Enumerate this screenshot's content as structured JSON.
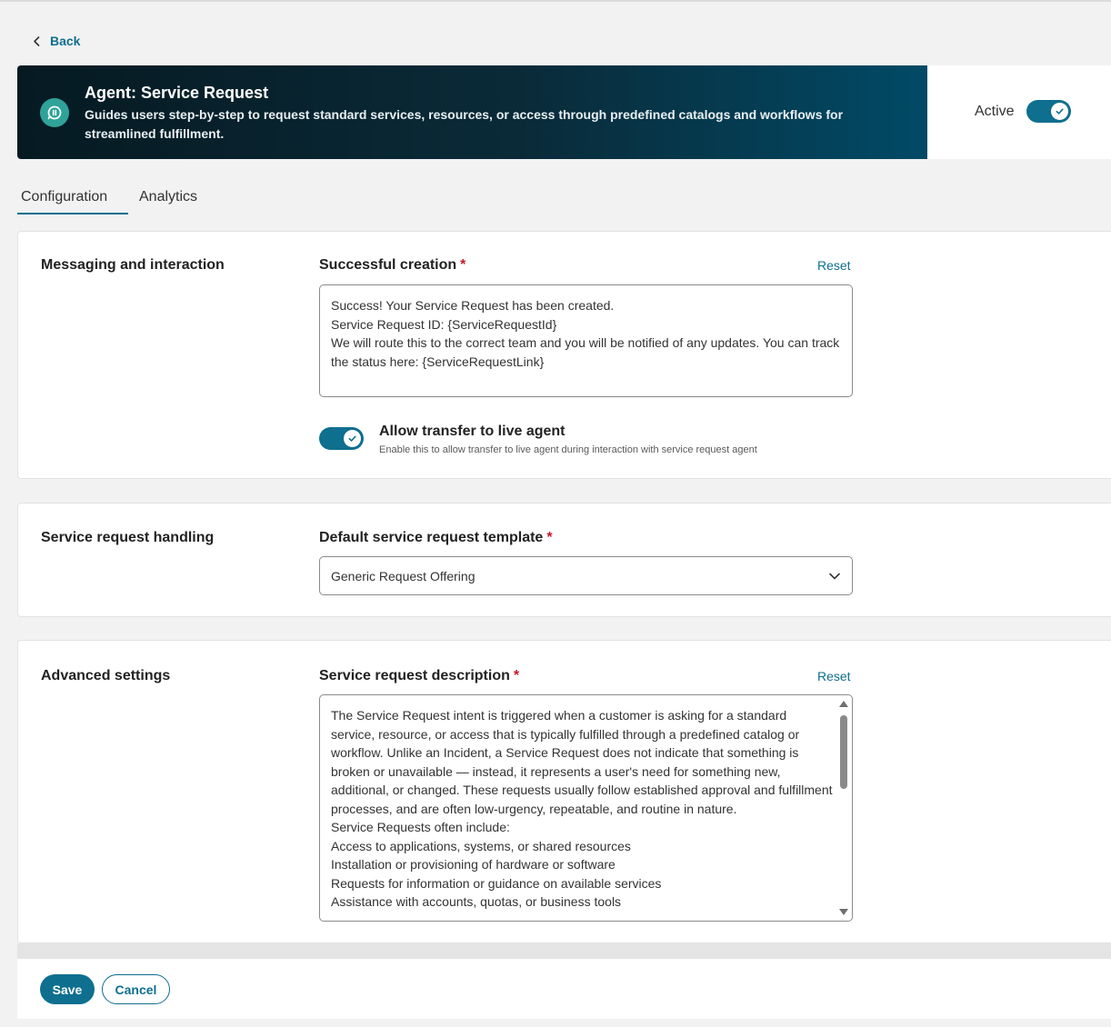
{
  "nav": {
    "back_label": "Back"
  },
  "banner": {
    "title": "Agent: Service Request",
    "description": "Guides users step-by-step to request standard services, resources, or access through predefined catalogs and workflows for streamlined fulfillment.",
    "icon": "chat-bubble-icon"
  },
  "status": {
    "label": "Active",
    "enabled": true
  },
  "tabs": [
    {
      "label": "Configuration",
      "selected": true
    },
    {
      "label": "Analytics",
      "selected": false
    }
  ],
  "messaging": {
    "section_title": "Messaging and interaction",
    "field_label": "Successful creation",
    "required_mark": "*",
    "reset_label": "Reset",
    "message_lines": [
      "Success! Your Service Request has been created.",
      "Service Request ID: {ServiceRequestId}",
      "We will route this to the correct team and you will be notified of any updates. You can track the status here: {ServiceRequestLink}"
    ],
    "transfer_title": "Allow transfer to live agent",
    "transfer_subtitle": "Enable this to allow transfer to live agent during interaction with service request agent",
    "transfer_enabled": true
  },
  "handling": {
    "section_title": "Service request handling",
    "field_label": "Default service request template",
    "required_mark": "*",
    "selected_value": "Generic Request Offering"
  },
  "advanced": {
    "section_title": "Advanced settings",
    "field_label": "Service request description",
    "required_mark": "*",
    "reset_label": "Reset",
    "description_lines": [
      "The Service Request intent is triggered when a customer is asking for a standard service, resource, or access that is typically fulfilled through a predefined catalog or workflow. Unlike an Incident, a Service Request does not indicate that something is broken or unavailable — instead, it represents a user's need for something new, additional, or changed. These requests usually follow established approval and fulfillment processes, and are often low-urgency, repeatable, and routine in nature.",
      "Service Requests often include:",
      "Access to applications, systems, or shared resources",
      "Installation or provisioning of hardware or software",
      "Requests for information or guidance on available services",
      "Assistance with accounts, quotas, or business tools"
    ]
  },
  "footer": {
    "save_label": "Save",
    "cancel_label": "Cancel"
  },
  "colors": {
    "accent": "#0e6f8f",
    "required": "#c4162a",
    "banner_icon": "#2fa39a"
  }
}
